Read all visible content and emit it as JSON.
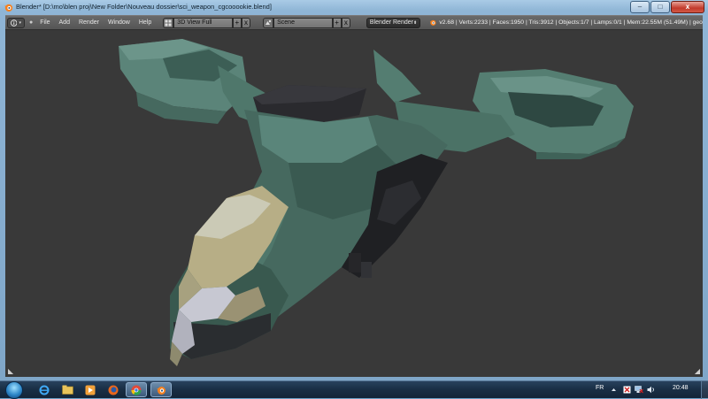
{
  "window": {
    "title": "Blender* [D:\\mo\\blen proj\\New Folder\\Nouveau dossier\\sci_weapon_cgcooookie.blend]",
    "minimize": "–",
    "maximize": "□",
    "close": "x"
  },
  "header": {
    "menus": [
      "File",
      "Add",
      "Render",
      "Window",
      "Help"
    ],
    "screen_layout": "3D View Full",
    "scene": "Scene",
    "render_engine": "Blender Render",
    "plus": "+",
    "x": "x",
    "stats": "v2.68 | Verts:2233 | Faces:1950 | Tris:3912 | Objects:1/7 | Lamps:0/1 | Mem:22.55M (51.49M) | geo"
  },
  "taskbar": {
    "language": "FR",
    "time": "20:48"
  },
  "colors": {
    "viewport_bg": "#393939",
    "hull_green": "#4e7468",
    "hull_dark": "#2a2a2e",
    "cockpit_tan": "#b7ae86",
    "cockpit_light": "#c7c8d2"
  },
  "icons": [
    "blender-logo-icon",
    "info-editor-icon",
    "screen-layout-icon",
    "scene-icon",
    "start-orb-icon",
    "ie-icon",
    "explorer-icon",
    "media-player-icon",
    "firefox-icon",
    "chrome-icon",
    "blender-taskbar-icon",
    "flag-icon",
    "network-icon",
    "volume-icon"
  ]
}
